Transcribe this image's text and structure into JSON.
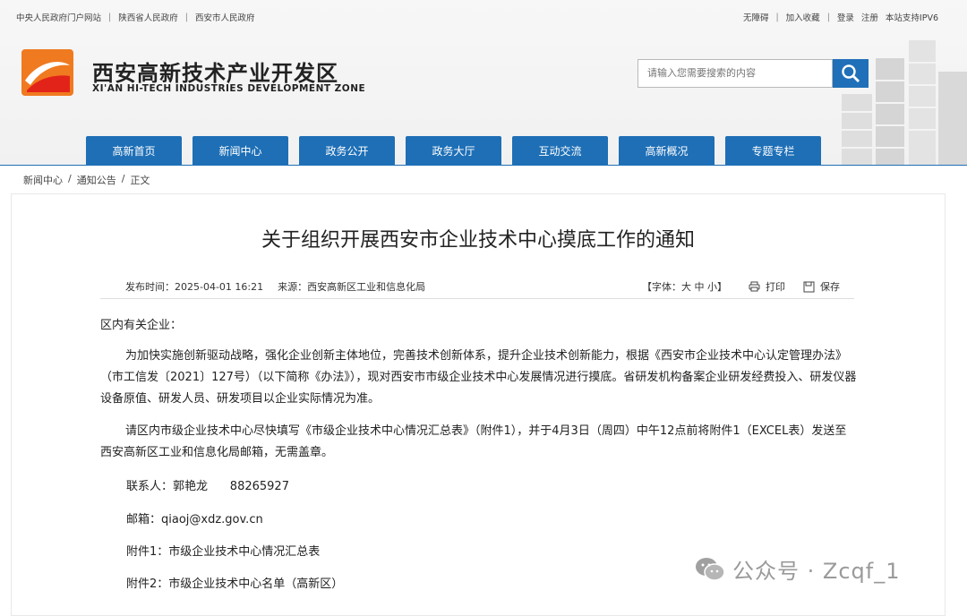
{
  "topbar": {
    "left_links": [
      "中央人民政府门户网站",
      "陕西省人民政府",
      "西安市人民政府"
    ],
    "right_links": [
      "无障碍",
      "加入收藏",
      "登录",
      "注册",
      "本站支持IPV6"
    ]
  },
  "header": {
    "site_name": "西安高新技术产业开发区",
    "site_en": "XI'AN HI-TECH INDUSTRIES DEVELOPMENT ZONE",
    "search_placeholder": "请输入您需要搜索的内容"
  },
  "nav": [
    "高新首页",
    "新闻中心",
    "政务公开",
    "政务大厅",
    "互动交流",
    "高新概况",
    "专题专栏"
  ],
  "breadcrumb": [
    "新闻中心",
    "/",
    "通知公告",
    "/",
    "正文"
  ],
  "article": {
    "title": "关于组织开展西安市企业技术中心摸底工作的通知",
    "publish_time": "发布时间：2025-04-01 16:21",
    "source": "来源：西安高新区工业和信息化局",
    "font_size_label": "【字体：大 中 小】",
    "print_label": "打印",
    "save_label": "保存",
    "greeting": "区内有关企业：",
    "paragraph1": "为加快实施创新驱动战略，强化企业创新主体地位，完善技术创新体系，提升企业技术创新能力，根据《西安市企业技术中心认定管理办法》（市工信发〔2021〕127号）（以下简称《办法》），现对西安市市级企业技术中心发展情况进行摸底。省研发机构备案企业研发经费投入、研发仪器设备原值、研发人员、研发项目以企业实际情况为准。",
    "paragraph2": "请区内市级企业技术中心尽快填写《市级企业技术中心情况汇总表》（附件1），并于4月3日（周四）中午12点前将附件1（EXCEL表）发送至西安高新区工业和信息化局邮箱，无需盖章。",
    "contact": "联系人：郭艳龙      88265927",
    "email": "邮箱：qiaoj@xdz.gov.cn",
    "attachment1": "附件1：市级企业技术中心情况汇总表",
    "attachment2": "附件2：市级企业技术中心名单（高新区）"
  },
  "watermark": "公众号 · Zcqf_1",
  "colors": {
    "nav_blue": "#1e6fb6",
    "logo_orange": "#f07a1f",
    "logo_red": "#e2231a"
  }
}
